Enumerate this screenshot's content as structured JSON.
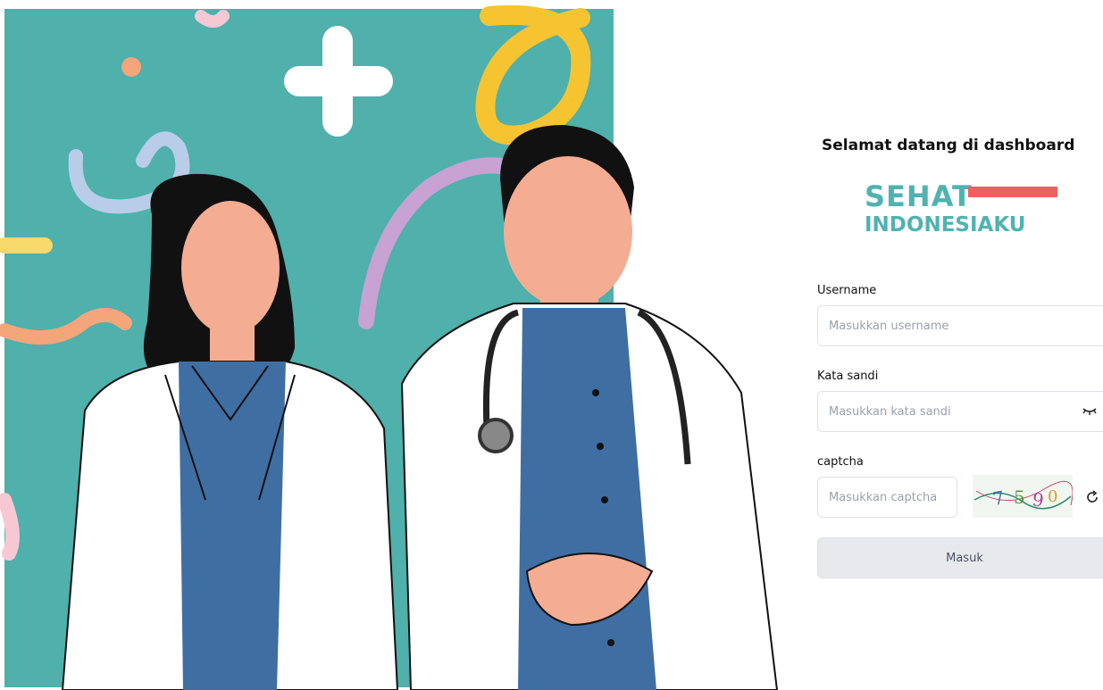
{
  "login": {
    "welcome_text": "Selamat datang di dashboard",
    "logo": {
      "line1": "SEHAT",
      "line2": "INDONESIAKU"
    },
    "username": {
      "label": "Username",
      "placeholder": "Masukkan username"
    },
    "password": {
      "label": "Kata sandi",
      "placeholder": "Masukkan kata sandi",
      "toggle_icon": "eye-closed-icon"
    },
    "captcha": {
      "label": "captcha",
      "placeholder": "Masukkan captcha",
      "refresh_icon": "refresh-icon"
    },
    "submit_label": "Masuk"
  },
  "colors": {
    "brand_teal": "#4fb3b1",
    "brand_red": "#ef5f5f",
    "hero_background": "#4fb0ac",
    "button_bg": "#e7e9ed"
  }
}
